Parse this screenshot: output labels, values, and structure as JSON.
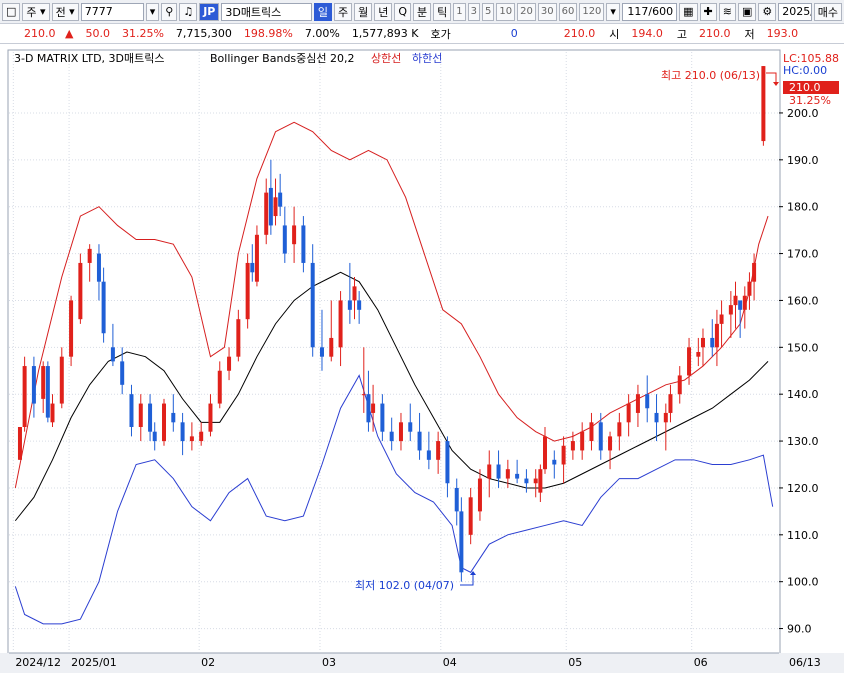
{
  "toolbar": {
    "market": "주",
    "prev_label": "전",
    "code": "7777",
    "jp_badge": "JP",
    "stock_name": "3D매트릭스",
    "periods": [
      "일",
      "주",
      "월",
      "년",
      "Q",
      "분",
      "틱"
    ],
    "selected_period": "일",
    "intervals": [
      "1",
      "3",
      "5",
      "10",
      "20",
      "30",
      "60",
      "120"
    ],
    "count": "117/600",
    "date": "2025/",
    "buy_label": "매수"
  },
  "quote": {
    "price": "210.0",
    "change": "50.0",
    "change_pct": "31.25%",
    "volume": "7,715,300",
    "volume_pct": "198.98%",
    "turnover_pct": "7.00%",
    "amount": "1,577,893 K",
    "hoga_label": "호가",
    "hoga_value": "0",
    "current": "210.0",
    "open_label": "시",
    "open": "194.0",
    "high_label": "고",
    "high": "210.0",
    "low_label": "저",
    "low": "193.0"
  },
  "legend": {
    "name": "3-D MATRIX LTD,  3D매트릭스",
    "indicator": "Bollinger Bands중심선 20,2",
    "upper": "상한선",
    "lower": "하한선",
    "lc": "LC:105.88",
    "hc": "HC:0.00"
  },
  "annotations": {
    "high": "최고 210.0 (06/13)",
    "low": "최저 102.0 (04/07)",
    "last_price": "210.0",
    "last_pct": "31.25%"
  },
  "colors": {
    "up": "#e0211b",
    "down": "#1f5fd6",
    "mid": "#000000",
    "upper": "#d61f1f",
    "lower": "#2b3ed1"
  },
  "chart_data": {
    "type": "candlestick",
    "ylim": [
      85,
      213
    ],
    "y_ticks": [
      "90.0",
      "100.0",
      "110.0",
      "120.0",
      "130.0",
      "140.0",
      "150.0",
      "160.0",
      "170.0",
      "180.0",
      "190.0",
      "200.0"
    ],
    "x_ticks": [
      {
        "label": "2024/12",
        "index": 0
      },
      {
        "label": "2025/01",
        "index": 12
      },
      {
        "label": "02",
        "index": 40
      },
      {
        "label": "03",
        "index": 66
      },
      {
        "label": "04",
        "index": 92
      },
      {
        "label": "05",
        "index": 119
      },
      {
        "label": "06",
        "index": 146
      },
      {
        "label": "06/13",
        "index": 162
      }
    ],
    "n": 164,
    "candles": [
      [
        1,
        126,
        133,
        126,
        133
      ],
      [
        2,
        133,
        148,
        132,
        146
      ],
      [
        4,
        146,
        148,
        135,
        138
      ],
      [
        6,
        139,
        147,
        136,
        146
      ],
      [
        7,
        146,
        147,
        134,
        135
      ],
      [
        8,
        134,
        140,
        133,
        138
      ],
      [
        10,
        138,
        150,
        137,
        148
      ],
      [
        12,
        148,
        161,
        146,
        160
      ],
      [
        14,
        156,
        170,
        155,
        168
      ],
      [
        16,
        168,
        172,
        164,
        171
      ],
      [
        18,
        170,
        172,
        160,
        164
      ],
      [
        19,
        164,
        167,
        151,
        153
      ],
      [
        21,
        150,
        155,
        146,
        147
      ],
      [
        23,
        147,
        150,
        140,
        142
      ],
      [
        25,
        140,
        142,
        131,
        133
      ],
      [
        27,
        133,
        140,
        130,
        138
      ],
      [
        29,
        138,
        140,
        130,
        132
      ],
      [
        30,
        132,
        134,
        128,
        130
      ],
      [
        32,
        130,
        139,
        129,
        138
      ],
      [
        34,
        136,
        140,
        132,
        134
      ],
      [
        36,
        134,
        136,
        127,
        130
      ],
      [
        38,
        130,
        134,
        128,
        131
      ],
      [
        40,
        130,
        134,
        129,
        132
      ],
      [
        42,
        132,
        140,
        131,
        138
      ],
      [
        44,
        138,
        147,
        137,
        145
      ],
      [
        46,
        145,
        150,
        143,
        148
      ],
      [
        48,
        148,
        158,
        147,
        156
      ],
      [
        50,
        156,
        170,
        154,
        168
      ],
      [
        51,
        168,
        172,
        164,
        166
      ],
      [
        52,
        164,
        176,
        163,
        174
      ],
      [
        54,
        174,
        186,
        172,
        183
      ],
      [
        55,
        184,
        190,
        174,
        176
      ],
      [
        56,
        178,
        186,
        176,
        182
      ],
      [
        57,
        183,
        187,
        178,
        180
      ],
      [
        58,
        176,
        180,
        168,
        170
      ],
      [
        60,
        172,
        180,
        168,
        176
      ],
      [
        62,
        176,
        178,
        166,
        168
      ],
      [
        64,
        168,
        172,
        148,
        150
      ],
      [
        66,
        150,
        158,
        145,
        148
      ],
      [
        68,
        148,
        160,
        147,
        152
      ],
      [
        70,
        150,
        162,
        146,
        160
      ],
      [
        72,
        160,
        168,
        155,
        158
      ],
      [
        73,
        160,
        165,
        156,
        163
      ],
      [
        74,
        160,
        162,
        155,
        158
      ],
      [
        75,
        140,
        150,
        136,
        140
      ],
      [
        76,
        140,
        145,
        132,
        134
      ],
      [
        77,
        136,
        142,
        132,
        138
      ],
      [
        79,
        138,
        140,
        130,
        132
      ],
      [
        81,
        132,
        135,
        128,
        130
      ],
      [
        83,
        130,
        136,
        128,
        134
      ],
      [
        85,
        134,
        138,
        130,
        132
      ],
      [
        87,
        132,
        136,
        126,
        128
      ],
      [
        89,
        128,
        132,
        124,
        126
      ],
      [
        91,
        126,
        132,
        123,
        130
      ],
      [
        93,
        130,
        131,
        118,
        121
      ],
      [
        95,
        120,
        122,
        112,
        115
      ],
      [
        96,
        115,
        118,
        100,
        102
      ],
      [
        98,
        110,
        120,
        108,
        118
      ],
      [
        100,
        115,
        124,
        113,
        122
      ],
      [
        102,
        122,
        128,
        118,
        125
      ],
      [
        104,
        125,
        128,
        120,
        122
      ],
      [
        106,
        122,
        126,
        120,
        124
      ],
      [
        108,
        123,
        126,
        121,
        122
      ],
      [
        110,
        122,
        124,
        119,
        121
      ],
      [
        112,
        121,
        124,
        118,
        122
      ],
      [
        113,
        119,
        125,
        117,
        124
      ],
      [
        114,
        124,
        133,
        123,
        131
      ],
      [
        116,
        126,
        128,
        122,
        125
      ],
      [
        118,
        125,
        131,
        121,
        129
      ],
      [
        120,
        128,
        132,
        126,
        130
      ],
      [
        122,
        128,
        134,
        126,
        132
      ],
      [
        124,
        130,
        136,
        128,
        134
      ],
      [
        126,
        134,
        136,
        126,
        128
      ],
      [
        128,
        128,
        132,
        124,
        131
      ],
      [
        130,
        131,
        136,
        128,
        134
      ],
      [
        132,
        134,
        140,
        131,
        138
      ],
      [
        134,
        136,
        142,
        133,
        140
      ],
      [
        136,
        140,
        144,
        134,
        137
      ],
      [
        138,
        136,
        140,
        130,
        134
      ],
      [
        140,
        134,
        138,
        128,
        136
      ],
      [
        141,
        136,
        142,
        134,
        140
      ],
      [
        143,
        140,
        146,
        138,
        144
      ],
      [
        145,
        144,
        152,
        142,
        150
      ],
      [
        147,
        148,
        152,
        146,
        149
      ],
      [
        148,
        150,
        154,
        146,
        152
      ],
      [
        150,
        152,
        156,
        148,
        150
      ],
      [
        151,
        150,
        158,
        146,
        155
      ],
      [
        152,
        155,
        160,
        150,
        157
      ],
      [
        154,
        157,
        162,
        152,
        159
      ],
      [
        155,
        159,
        164,
        154,
        161
      ],
      [
        156,
        160,
        160,
        152,
        158
      ],
      [
        157,
        158,
        163,
        154,
        161
      ],
      [
        158,
        161,
        166,
        158,
        164
      ],
      [
        159,
        164,
        170,
        160,
        168
      ],
      [
        161,
        194,
        210,
        193,
        210
      ]
    ],
    "upper_band": [
      [
        0,
        120
      ],
      [
        5,
        145
      ],
      [
        10,
        165
      ],
      [
        14,
        178
      ],
      [
        18,
        180
      ],
      [
        22,
        176
      ],
      [
        26,
        173
      ],
      [
        30,
        173
      ],
      [
        34,
        172
      ],
      [
        38,
        165
      ],
      [
        42,
        148
      ],
      [
        45,
        150
      ],
      [
        48,
        170
      ],
      [
        52,
        186
      ],
      [
        56,
        196
      ],
      [
        60,
        198
      ],
      [
        64,
        196
      ],
      [
        68,
        192
      ],
      [
        72,
        190
      ],
      [
        76,
        192
      ],
      [
        80,
        190
      ],
      [
        84,
        182
      ],
      [
        88,
        170
      ],
      [
        92,
        158
      ],
      [
        96,
        155
      ],
      [
        100,
        148
      ],
      [
        104,
        140
      ],
      [
        108,
        135
      ],
      [
        112,
        132
      ],
      [
        116,
        130
      ],
      [
        120,
        131
      ],
      [
        124,
        133
      ],
      [
        128,
        136
      ],
      [
        132,
        138
      ],
      [
        136,
        140
      ],
      [
        140,
        142
      ],
      [
        144,
        143
      ],
      [
        148,
        146
      ],
      [
        152,
        150
      ],
      [
        156,
        155
      ],
      [
        158,
        162
      ],
      [
        160,
        172
      ],
      [
        162,
        178
      ]
    ],
    "middle_band": [
      [
        0,
        113
      ],
      [
        4,
        118
      ],
      [
        8,
        126
      ],
      [
        12,
        135
      ],
      [
        16,
        142
      ],
      [
        20,
        147
      ],
      [
        24,
        149
      ],
      [
        28,
        148
      ],
      [
        32,
        145
      ],
      [
        36,
        139
      ],
      [
        40,
        134
      ],
      [
        44,
        134
      ],
      [
        48,
        140
      ],
      [
        52,
        148
      ],
      [
        56,
        155
      ],
      [
        60,
        160
      ],
      [
        64,
        163
      ],
      [
        68,
        165
      ],
      [
        70,
        166
      ],
      [
        74,
        164
      ],
      [
        78,
        158
      ],
      [
        82,
        150
      ],
      [
        86,
        142
      ],
      [
        90,
        135
      ],
      [
        94,
        128
      ],
      [
        98,
        124
      ],
      [
        102,
        122
      ],
      [
        106,
        121
      ],
      [
        110,
        120
      ],
      [
        114,
        120
      ],
      [
        118,
        121
      ],
      [
        122,
        123
      ],
      [
        126,
        125
      ],
      [
        130,
        127
      ],
      [
        134,
        129
      ],
      [
        138,
        131
      ],
      [
        142,
        133
      ],
      [
        146,
        135
      ],
      [
        150,
        137
      ],
      [
        154,
        140
      ],
      [
        158,
        143
      ],
      [
        162,
        147
      ]
    ],
    "lower_band": [
      [
        0,
        99
      ],
      [
        2,
        93
      ],
      [
        6,
        91
      ],
      [
        10,
        91
      ],
      [
        14,
        92
      ],
      [
        18,
        100
      ],
      [
        22,
        115
      ],
      [
        26,
        125
      ],
      [
        30,
        126
      ],
      [
        34,
        122
      ],
      [
        38,
        116
      ],
      [
        42,
        113
      ],
      [
        46,
        119
      ],
      [
        50,
        122
      ],
      [
        54,
        114
      ],
      [
        58,
        113
      ],
      [
        62,
        114
      ],
      [
        66,
        125
      ],
      [
        70,
        137
      ],
      [
        74,
        144
      ],
      [
        78,
        131
      ],
      [
        82,
        123
      ],
      [
        86,
        119
      ],
      [
        90,
        117
      ],
      [
        94,
        112
      ],
      [
        96,
        103
      ],
      [
        98,
        102
      ],
      [
        102,
        108
      ],
      [
        106,
        110
      ],
      [
        110,
        111
      ],
      [
        114,
        112
      ],
      [
        118,
        113
      ],
      [
        122,
        112
      ],
      [
        126,
        118
      ],
      [
        130,
        122
      ],
      [
        134,
        122
      ],
      [
        138,
        124
      ],
      [
        142,
        126
      ],
      [
        146,
        126
      ],
      [
        150,
        125
      ],
      [
        154,
        125
      ],
      [
        158,
        126
      ],
      [
        161,
        127
      ],
      [
        163,
        116
      ]
    ]
  }
}
